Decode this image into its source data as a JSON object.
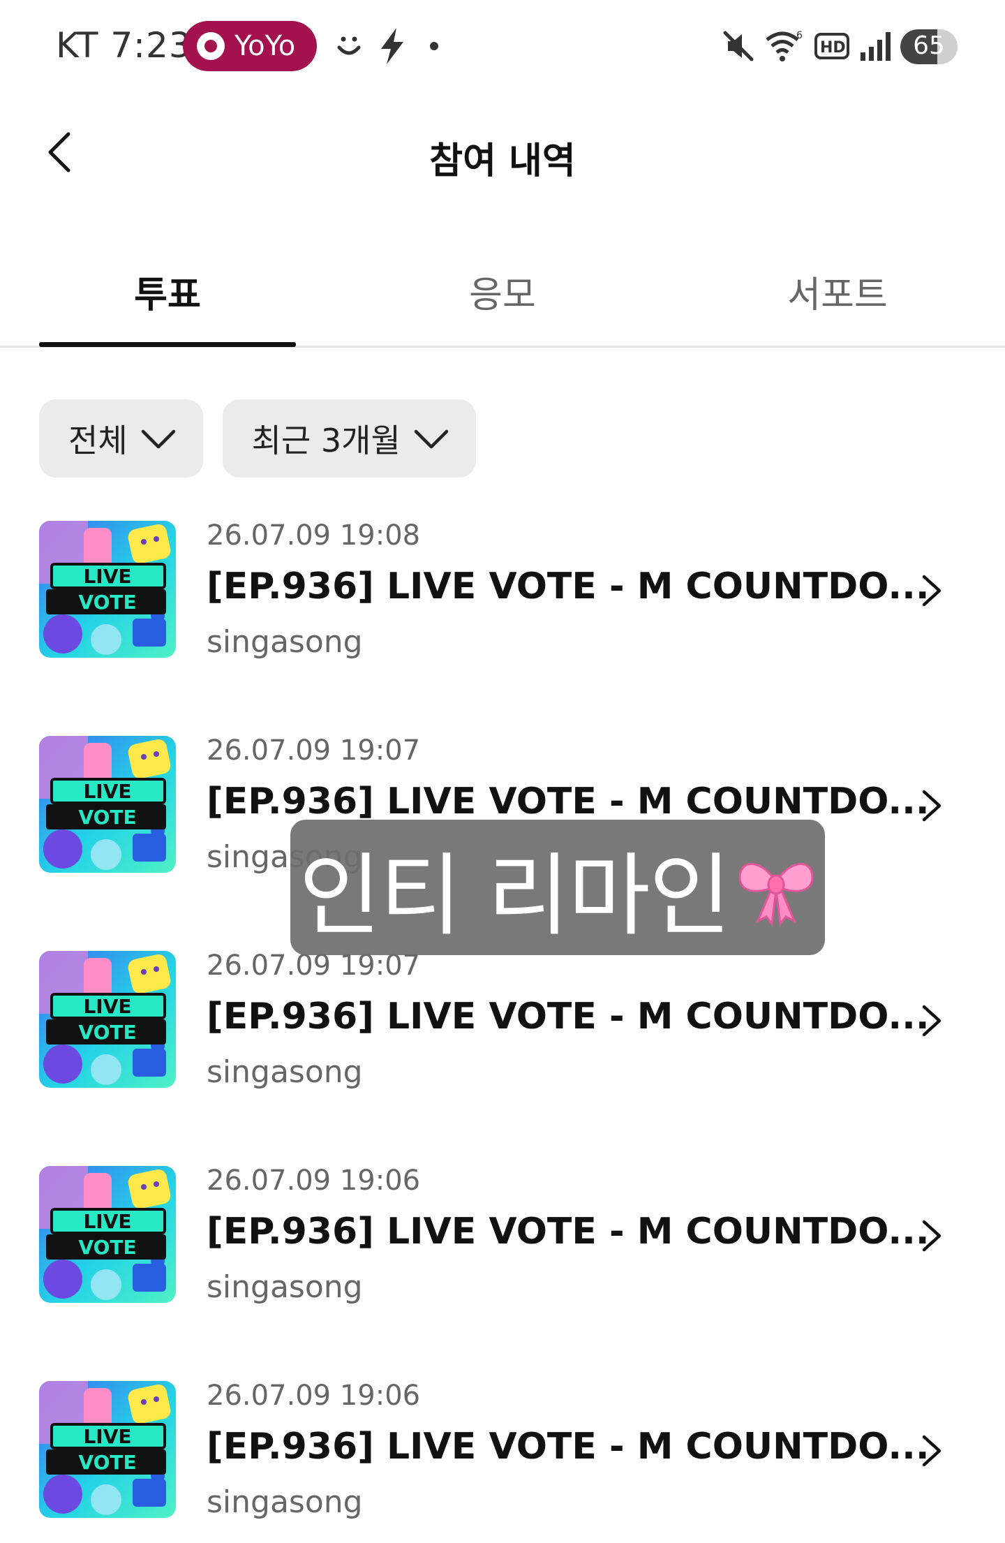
{
  "status_bar": {
    "carrier": "KT",
    "time": "7:23",
    "pill_label": "YoYo",
    "battery": "65",
    "battery_level": 0.65,
    "icons": [
      "smiley-icon",
      "bolt-icon",
      "dot-icon",
      "mute-icon",
      "wifi-icon",
      "hd-icon",
      "signal-icon"
    ]
  },
  "header": {
    "title": "참여 내역"
  },
  "tabs": [
    {
      "label": "투표",
      "active": true
    },
    {
      "label": "응모",
      "active": false
    },
    {
      "label": "서포트",
      "active": false
    }
  ],
  "filters": {
    "category": "전체",
    "period": "최근 3개월"
  },
  "items": [
    {
      "date": "26.07.09 19:08",
      "title": "[EP.936] LIVE VOTE - M COUNTDO...",
      "subtitle": "singasong"
    },
    {
      "date": "26.07.09 19:07",
      "title": "[EP.936] LIVE VOTE - M COUNTDO...",
      "subtitle": "singasong"
    },
    {
      "date": "26.07.09 19:07",
      "title": "[EP.936] LIVE VOTE - M COUNTDO...",
      "subtitle": "singasong"
    },
    {
      "date": "26.07.09 19:06",
      "title": "[EP.936] LIVE VOTE - M COUNTDO...",
      "subtitle": "singasong"
    },
    {
      "date": "26.07.09 19:06",
      "title": "[EP.936] LIVE VOTE - M COUNTDO...",
      "subtitle": "singasong"
    }
  ],
  "thumbnail": {
    "line1": "LIVE",
    "line2": "VOTE"
  },
  "sticker": {
    "text": "인티 리마인",
    "emoji": "ribbon-bow-icon"
  },
  "colors": {
    "accent": "#a3124e",
    "tab_active": "#111111",
    "filter_bg": "#ebebeb",
    "secondary_text": "#666666"
  }
}
